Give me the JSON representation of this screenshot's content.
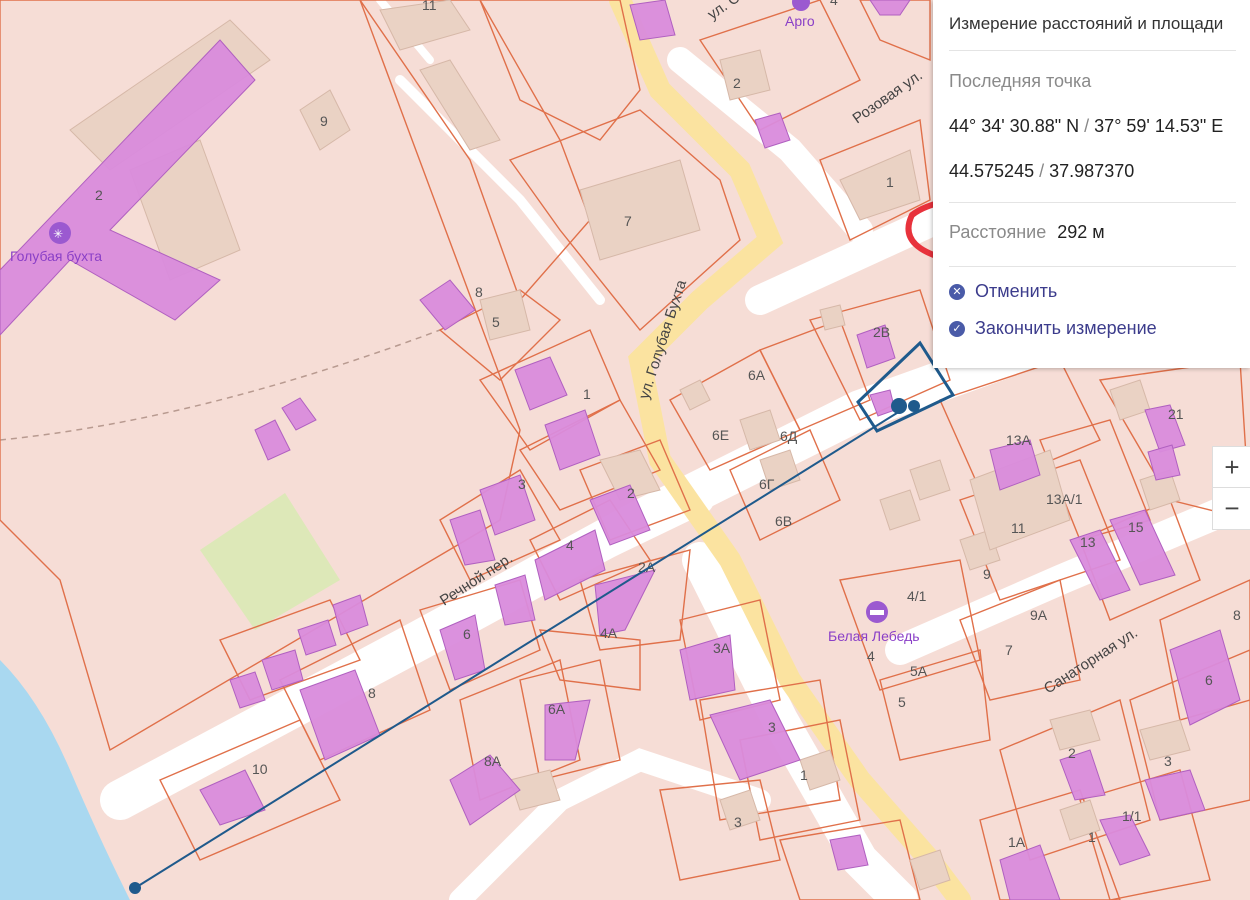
{
  "panel": {
    "title": "Измерение расстояний и площади",
    "last_point_label": "Последняя точка",
    "dms_lat": "44° 34' 30.88\" N",
    "dms_lon": "37° 59' 14.53\" E",
    "dec_lat": "44.575245",
    "dec_lon": "37.987370",
    "coord_separator": "/",
    "distance_label": "Расстояние",
    "distance_value": "292 м",
    "cancel_label": "Отменить",
    "finish_label": "Закончить измерение",
    "highlight_color": "#e8323c"
  },
  "zoom": {
    "in": "+",
    "out": "−"
  },
  "map": {
    "colors": {
      "parcel_fill": "#f6ddd6",
      "parcel_stroke": "#e0704a",
      "building": "#d98bdc",
      "road": "#ffffff",
      "main_road": "#fbe3a0",
      "water": "#a9d8f0",
      "green": "#dde8b8",
      "measure_line": "#1f5a8c"
    },
    "pois": {
      "golubaya_bukhta": "Голубая бухта",
      "argo": "Арго",
      "belaya_lebed": "Белая Лебедь"
    },
    "streets": {
      "golubaya_bukhta": "ул. Голубая Бухта",
      "rozovaya": "Розовая ул.",
      "rechnoy": "Речной пер.",
      "sanatornaya": "Санаторная ул.",
      "top_partial": "ул. С"
    },
    "house_numbers": {
      "h11a": "11",
      "h9a": "9",
      "h2a": "2",
      "h8a": "8",
      "h5a": "5",
      "h1a": "1",
      "h3a": "3",
      "h7a": "7",
      "h2b": "2",
      "h4b": "4",
      "h1b": "1",
      "h4c": "4",
      "h2v": "2В",
      "h6a": "6А",
      "h6e": "6Е",
      "h6d": "6Д",
      "h6g": "6Г",
      "h6v": "6В",
      "h2c": "2",
      "h4d": "4",
      "h2a2": "2А",
      "h4a": "4А",
      "h6b": "6",
      "h3a2": "3А",
      "h6a2": "6А",
      "h8a2": "8А",
      "h8b": "8",
      "h10": "10",
      "h3b": "3",
      "h1c": "1",
      "h3c": "3",
      "h13a": "13А",
      "h13a1": "13А/1",
      "h11b": "11",
      "h13": "13",
      "h15": "15",
      "h21": "21",
      "h9b": "9",
      "h9a2": "9А",
      "h41": "4/1",
      "h4e": "4",
      "h5a2": "5А",
      "h5": "5",
      "h7b": "7",
      "h8c": "8",
      "h6c": "6",
      "h2d": "2",
      "h3d": "3",
      "h11c": "1/1",
      "h1d": "1",
      "h1a2": "1А"
    }
  }
}
